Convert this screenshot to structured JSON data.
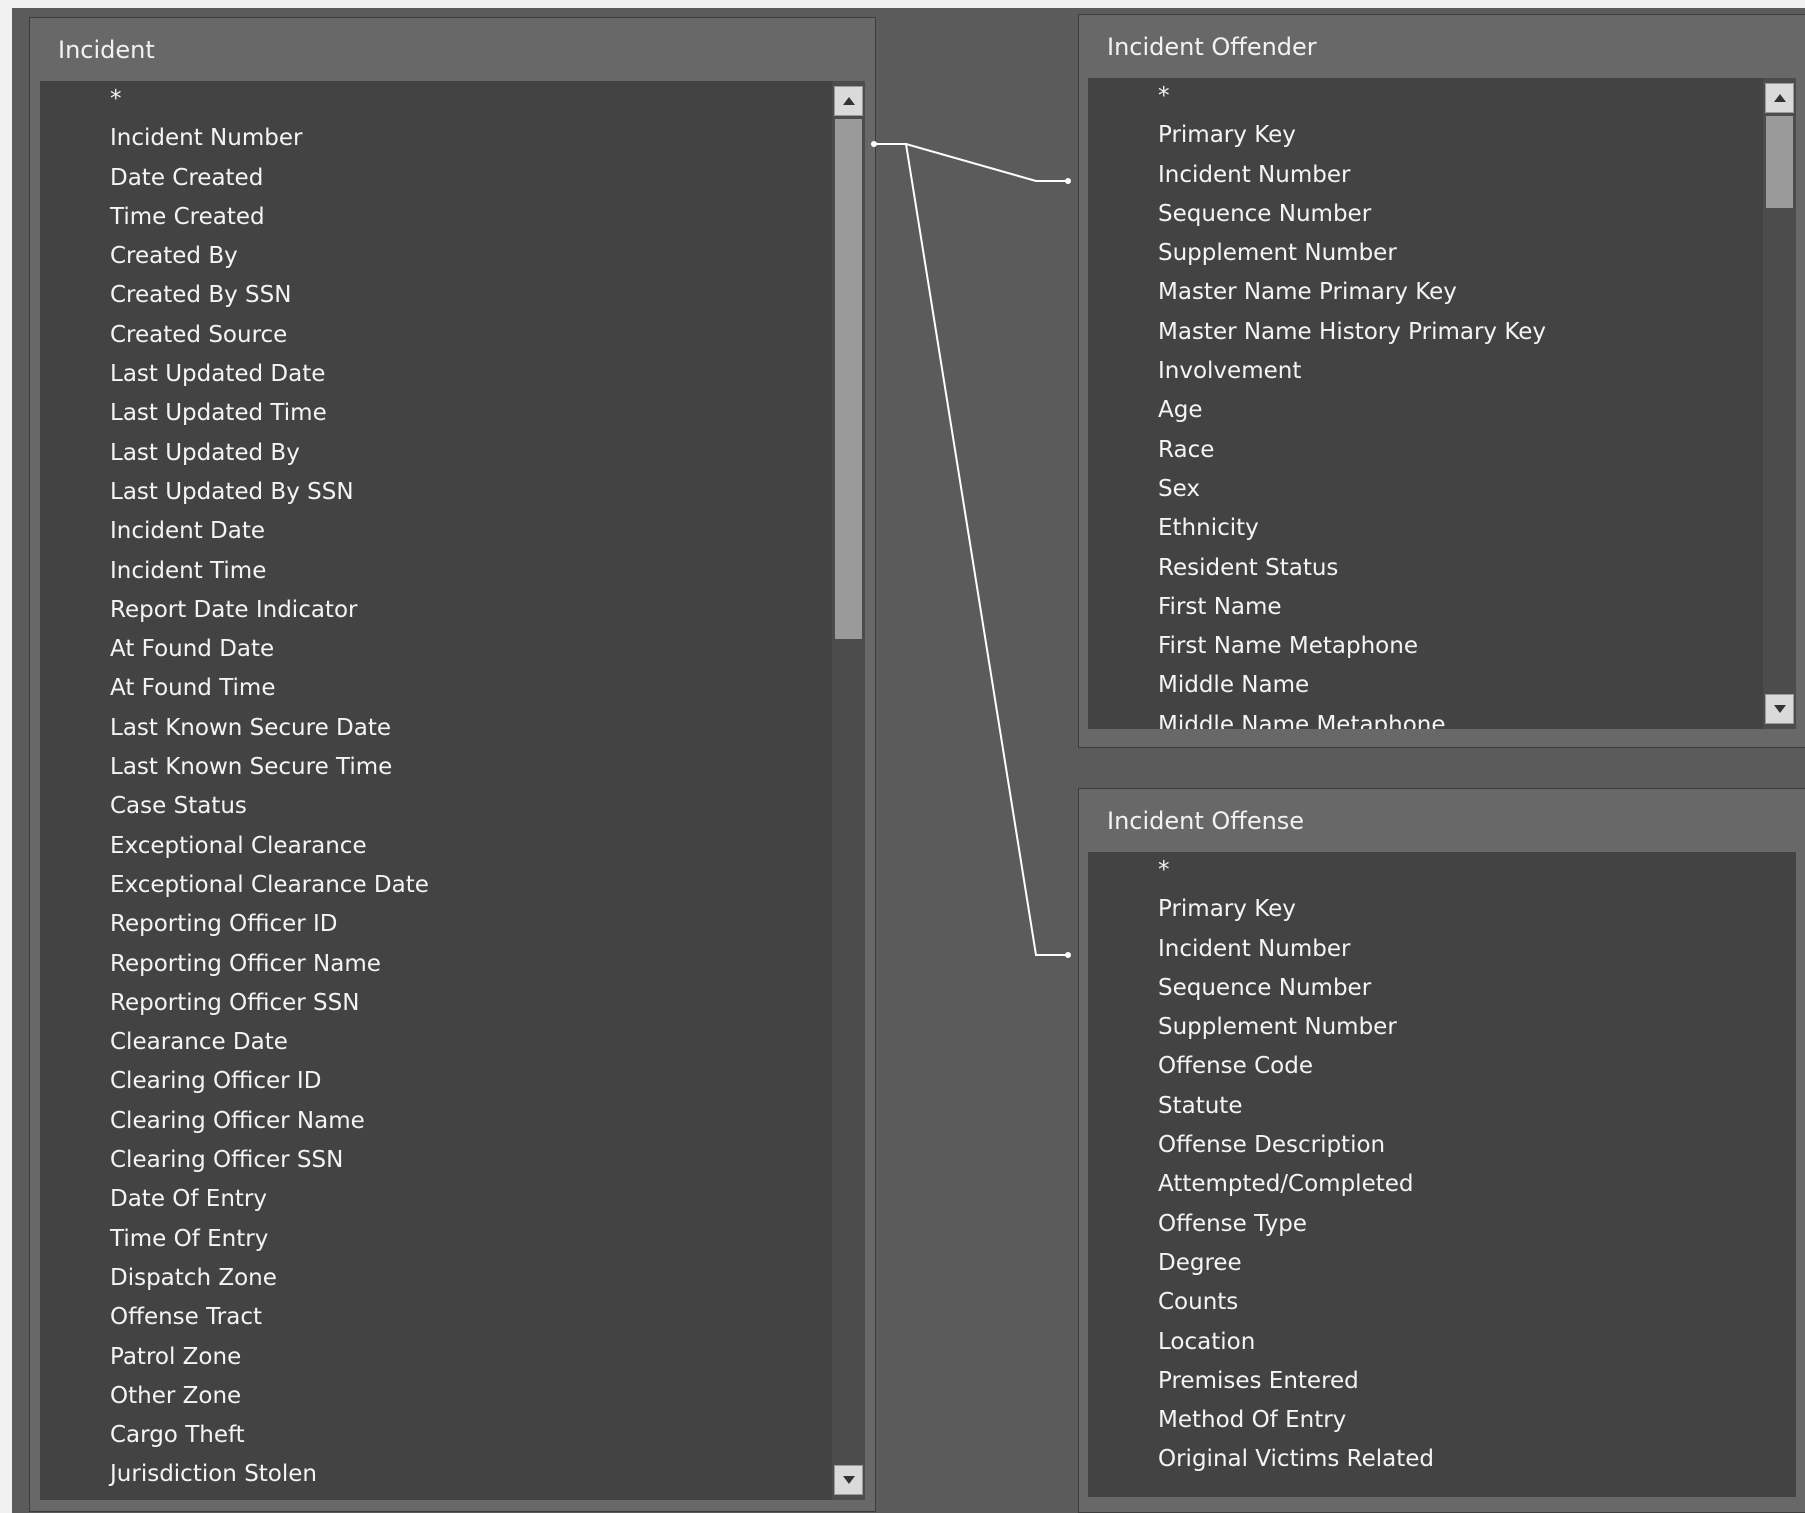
{
  "tables": {
    "incident": {
      "title": "Incident",
      "fields": [
        "*",
        "Incident Number",
        "Date Created",
        "Time Created",
        "Created By",
        "Created By SSN",
        "Created Source",
        "Last Updated Date",
        "Last Updated Time",
        "Last Updated By",
        "Last Updated By SSN",
        "Incident Date",
        "Incident Time",
        "Report Date Indicator",
        "At Found Date",
        "At Found Time",
        "Last Known Secure Date",
        "Last Known Secure Time",
        "Case Status",
        "Exceptional Clearance",
        "Exceptional Clearance Date",
        "Reporting Officer ID",
        "Reporting Officer Name",
        "Reporting Officer SSN",
        "Clearance Date",
        "Clearing Officer ID",
        "Clearing Officer Name",
        "Clearing Officer SSN",
        "Date Of Entry",
        "Time Of Entry",
        "Dispatch Zone",
        "Offense Tract",
        "Patrol Zone",
        "Other Zone",
        "Cargo Theft",
        "Jurisdiction Stolen"
      ]
    },
    "incident_offender": {
      "title": "Incident Offender",
      "fields": [
        "*",
        "Primary Key",
        "Incident Number",
        "Sequence Number",
        "Supplement Number",
        "Master Name Primary Key",
        "Master Name History Primary Key",
        "Involvement",
        "Age",
        "Race",
        "Sex",
        "Ethnicity",
        "Resident Status",
        "First Name",
        "First Name Metaphone",
        "Middle Name",
        "Middle Name Metaphone"
      ]
    },
    "incident_offense": {
      "title": "Incident Offense",
      "fields": [
        "*",
        "Primary Key",
        "Incident Number",
        "Sequence Number",
        "Supplement Number",
        "Offense Code",
        "Statute",
        "Offense Description",
        "Attempted/Completed",
        "Offense Type",
        "Degree",
        "Counts",
        "Location",
        "Premises Entered",
        "Method Of Entry",
        "Original Victims Related"
      ]
    }
  },
  "icons": {
    "scroll_up": "triangle-up-icon",
    "scroll_down": "triangle-down-icon"
  },
  "colors": {
    "canvas": "#5b5b5b",
    "table_frame": "#686868",
    "list_background": "#434343",
    "text": "#f4f4f4",
    "connector": "#ffffff"
  }
}
